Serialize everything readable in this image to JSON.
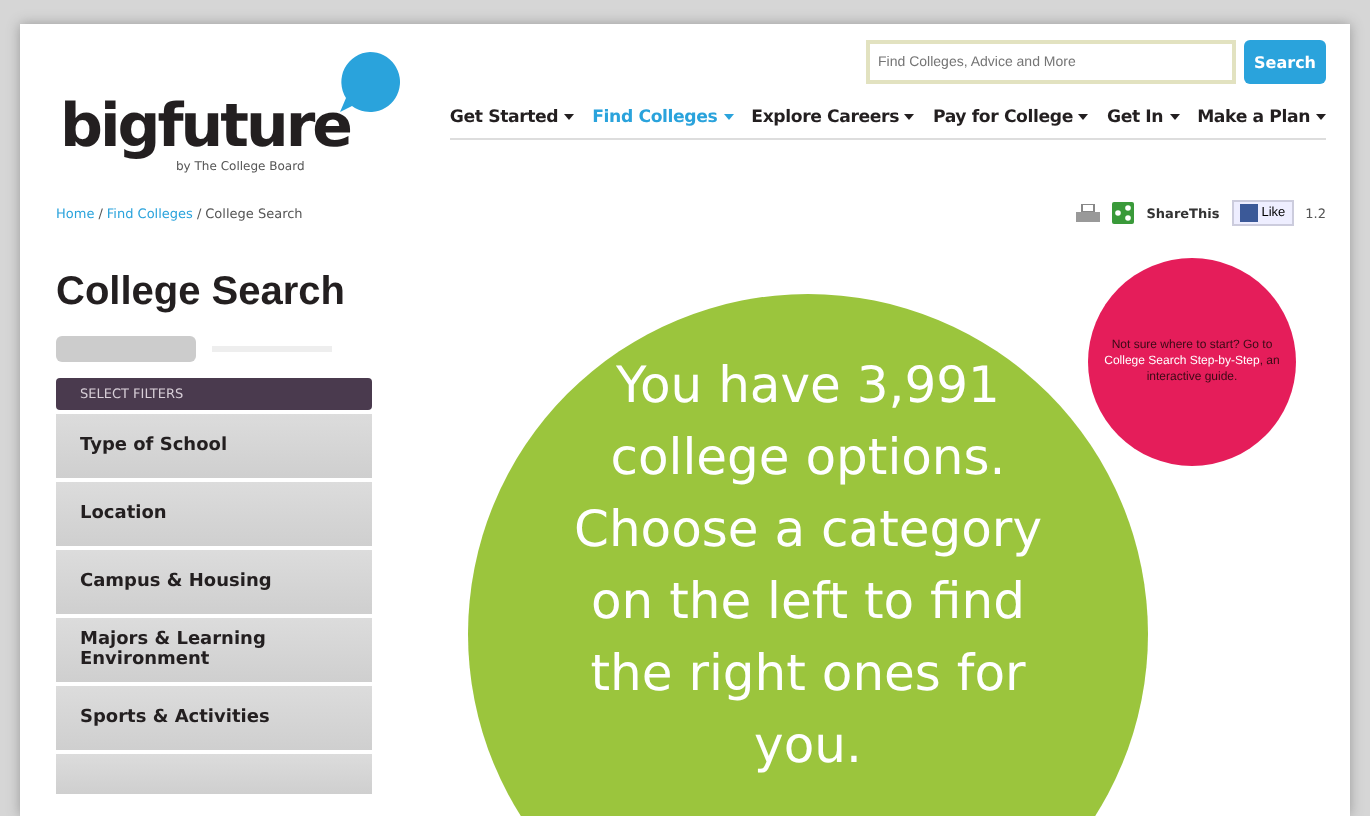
{
  "logo": {
    "name": "bigfuture",
    "tagline": "by The College Board"
  },
  "search": {
    "placeholder": "Find Colleges, Advice and More",
    "button": "Search"
  },
  "nav": [
    {
      "label": "Get Started",
      "selected": false
    },
    {
      "label": "Find Colleges",
      "selected": true
    },
    {
      "label": "Explore Careers",
      "selected": false
    },
    {
      "label": "Pay for College",
      "selected": false
    },
    {
      "label": "Get In",
      "selected": false
    },
    {
      "label": "Make a Plan",
      "selected": false
    }
  ],
  "breadcrumb_separator": "/",
  "breadcrumb": [
    {
      "label": "Home",
      "link": true
    },
    {
      "label": "Find Colleges",
      "link": true
    },
    {
      "label": "College Search",
      "link": false
    }
  ],
  "share": {
    "share_label": "ShareThis",
    "like_label": "Like",
    "like_count": "1.2"
  },
  "sidebar": {
    "title": "College Search",
    "filter_header": "SELECT FILTERS",
    "items": [
      "Type of School",
      "Location",
      "Campus & Housing",
      "Majors & Learning Environment",
      "Sports & Activities"
    ]
  },
  "message": "You have 3,991 college options. Choose a category on the left to find the right ones for you.",
  "guide": {
    "before": "Not sure where to start? Go to",
    "link": "College Search Step-by-Step",
    "after": ", an interactive guide."
  }
}
